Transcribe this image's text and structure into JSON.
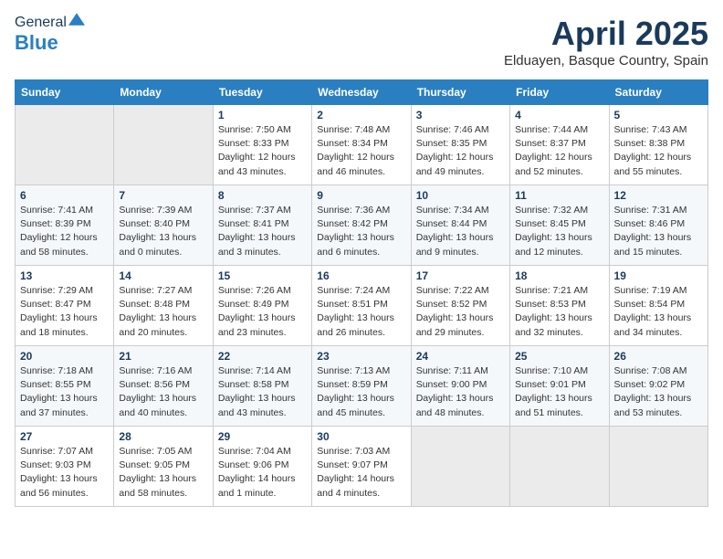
{
  "header": {
    "logo_general": "General",
    "logo_blue": "Blue",
    "title_month": "April 2025",
    "title_location": "Elduayen, Basque Country, Spain"
  },
  "columns": [
    "Sunday",
    "Monday",
    "Tuesday",
    "Wednesday",
    "Thursday",
    "Friday",
    "Saturday"
  ],
  "weeks": [
    [
      {
        "num": "",
        "detail": ""
      },
      {
        "num": "",
        "detail": ""
      },
      {
        "num": "1",
        "detail": "Sunrise: 7:50 AM\nSunset: 8:33 PM\nDaylight: 12 hours and 43 minutes."
      },
      {
        "num": "2",
        "detail": "Sunrise: 7:48 AM\nSunset: 8:34 PM\nDaylight: 12 hours and 46 minutes."
      },
      {
        "num": "3",
        "detail": "Sunrise: 7:46 AM\nSunset: 8:35 PM\nDaylight: 12 hours and 49 minutes."
      },
      {
        "num": "4",
        "detail": "Sunrise: 7:44 AM\nSunset: 8:37 PM\nDaylight: 12 hours and 52 minutes."
      },
      {
        "num": "5",
        "detail": "Sunrise: 7:43 AM\nSunset: 8:38 PM\nDaylight: 12 hours and 55 minutes."
      }
    ],
    [
      {
        "num": "6",
        "detail": "Sunrise: 7:41 AM\nSunset: 8:39 PM\nDaylight: 12 hours and 58 minutes."
      },
      {
        "num": "7",
        "detail": "Sunrise: 7:39 AM\nSunset: 8:40 PM\nDaylight: 13 hours and 0 minutes."
      },
      {
        "num": "8",
        "detail": "Sunrise: 7:37 AM\nSunset: 8:41 PM\nDaylight: 13 hours and 3 minutes."
      },
      {
        "num": "9",
        "detail": "Sunrise: 7:36 AM\nSunset: 8:42 PM\nDaylight: 13 hours and 6 minutes."
      },
      {
        "num": "10",
        "detail": "Sunrise: 7:34 AM\nSunset: 8:44 PM\nDaylight: 13 hours and 9 minutes."
      },
      {
        "num": "11",
        "detail": "Sunrise: 7:32 AM\nSunset: 8:45 PM\nDaylight: 13 hours and 12 minutes."
      },
      {
        "num": "12",
        "detail": "Sunrise: 7:31 AM\nSunset: 8:46 PM\nDaylight: 13 hours and 15 minutes."
      }
    ],
    [
      {
        "num": "13",
        "detail": "Sunrise: 7:29 AM\nSunset: 8:47 PM\nDaylight: 13 hours and 18 minutes."
      },
      {
        "num": "14",
        "detail": "Sunrise: 7:27 AM\nSunset: 8:48 PM\nDaylight: 13 hours and 20 minutes."
      },
      {
        "num": "15",
        "detail": "Sunrise: 7:26 AM\nSunset: 8:49 PM\nDaylight: 13 hours and 23 minutes."
      },
      {
        "num": "16",
        "detail": "Sunrise: 7:24 AM\nSunset: 8:51 PM\nDaylight: 13 hours and 26 minutes."
      },
      {
        "num": "17",
        "detail": "Sunrise: 7:22 AM\nSunset: 8:52 PM\nDaylight: 13 hours and 29 minutes."
      },
      {
        "num": "18",
        "detail": "Sunrise: 7:21 AM\nSunset: 8:53 PM\nDaylight: 13 hours and 32 minutes."
      },
      {
        "num": "19",
        "detail": "Sunrise: 7:19 AM\nSunset: 8:54 PM\nDaylight: 13 hours and 34 minutes."
      }
    ],
    [
      {
        "num": "20",
        "detail": "Sunrise: 7:18 AM\nSunset: 8:55 PM\nDaylight: 13 hours and 37 minutes."
      },
      {
        "num": "21",
        "detail": "Sunrise: 7:16 AM\nSunset: 8:56 PM\nDaylight: 13 hours and 40 minutes."
      },
      {
        "num": "22",
        "detail": "Sunrise: 7:14 AM\nSunset: 8:58 PM\nDaylight: 13 hours and 43 minutes."
      },
      {
        "num": "23",
        "detail": "Sunrise: 7:13 AM\nSunset: 8:59 PM\nDaylight: 13 hours and 45 minutes."
      },
      {
        "num": "24",
        "detail": "Sunrise: 7:11 AM\nSunset: 9:00 PM\nDaylight: 13 hours and 48 minutes."
      },
      {
        "num": "25",
        "detail": "Sunrise: 7:10 AM\nSunset: 9:01 PM\nDaylight: 13 hours and 51 minutes."
      },
      {
        "num": "26",
        "detail": "Sunrise: 7:08 AM\nSunset: 9:02 PM\nDaylight: 13 hours and 53 minutes."
      }
    ],
    [
      {
        "num": "27",
        "detail": "Sunrise: 7:07 AM\nSunset: 9:03 PM\nDaylight: 13 hours and 56 minutes."
      },
      {
        "num": "28",
        "detail": "Sunrise: 7:05 AM\nSunset: 9:05 PM\nDaylight: 13 hours and 58 minutes."
      },
      {
        "num": "29",
        "detail": "Sunrise: 7:04 AM\nSunset: 9:06 PM\nDaylight: 14 hours and 1 minute."
      },
      {
        "num": "30",
        "detail": "Sunrise: 7:03 AM\nSunset: 9:07 PM\nDaylight: 14 hours and 4 minutes."
      },
      {
        "num": "",
        "detail": ""
      },
      {
        "num": "",
        "detail": ""
      },
      {
        "num": "",
        "detail": ""
      }
    ]
  ]
}
